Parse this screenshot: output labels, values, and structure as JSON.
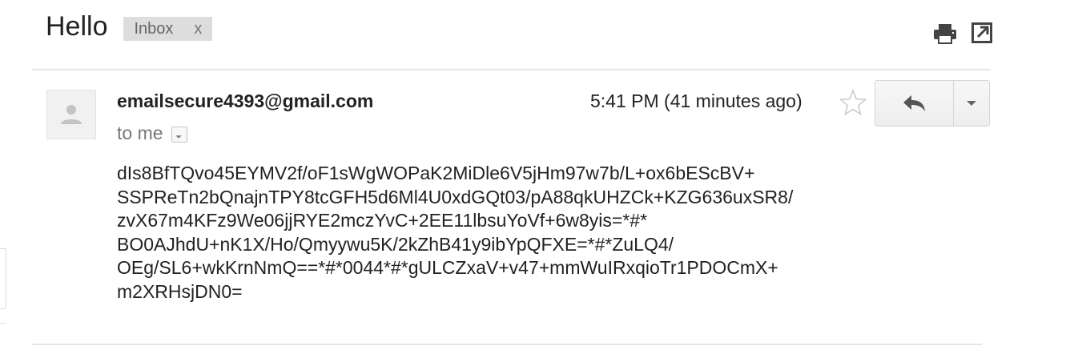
{
  "message": {
    "subject": "Hello",
    "label": {
      "name": "Inbox",
      "remove": "x"
    },
    "sender": "emailsecure4393@gmail.com",
    "recipient": "to me",
    "time": "5:41 PM (41 minutes ago)",
    "body_lines": [
      "dIs8BfTQvo45EYMV2f/oF1sWgWOPaK2MiDle6V5jHm97w7b/L+ox6bEScBV+",
      "SSPReTn2bQnajnTPY8tcGFH5d6Ml4U0xdGQt03/pA88qkUHZCk+KZG636uxSR8/",
      "zvX67m4KFz9We06jjRYE2mczYvC+2EE11lbsuYoVf+6w8yis=*#*",
      "BO0AJhdU+nK1X/Ho/Qmyywu5K/2kZhB41y9ibYpQFXE=*#*ZuLQ4/",
      "OEg/SL6+wkKrnNmQ==*#*0044*#*gULCZxaV+v47+mmWuIRxqioTr1PDOCmX+",
      "m2XRHsjDN0="
    ]
  },
  "icons": {
    "print": "print-icon",
    "new_window": "new-window-icon",
    "avatar": "person-icon",
    "details": "dropdown-icon",
    "star": "star-icon",
    "reply": "reply-icon",
    "more": "chevron-down-icon"
  },
  "colors": {
    "text": "#222222",
    "muted": "#777777",
    "chip_bg": "#dddddd",
    "divider": "#e5e5e5"
  }
}
